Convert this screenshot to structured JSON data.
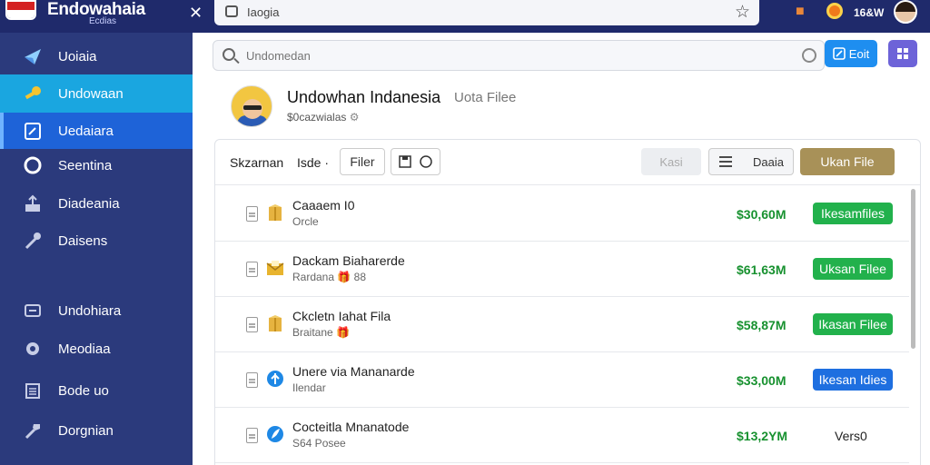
{
  "brand": {
    "title": "Endowahaia",
    "subtitle": "Ecdias",
    "flag_colors": [
      "#d42121",
      "#ffffff"
    ]
  },
  "address_bar": {
    "url": "Iaogia"
  },
  "top_right": {
    "price": "16&W"
  },
  "sidebar": {
    "items": [
      {
        "label": "Uoiaia",
        "icon": "send-icon"
      },
      {
        "label": "Undowaan",
        "icon": "key-icon"
      },
      {
        "label": "Uedaiara",
        "icon": "pen-card-icon"
      },
      {
        "label": "Seentina",
        "icon": "circle-icon"
      },
      {
        "label": "Diadeania",
        "icon": "upload-icon"
      },
      {
        "label": "Daisens",
        "icon": "wrench-icon"
      },
      {
        "label": "Undohiara",
        "icon": "minus-box-icon"
      },
      {
        "label": "Meodiaa",
        "icon": "gear-icon"
      },
      {
        "label": "Bode uo",
        "icon": "calendar-icon"
      },
      {
        "label": "Dorgnian",
        "icon": "tool-icon"
      }
    ]
  },
  "search": {
    "placeholder": "Undomedan"
  },
  "header_buttons": {
    "edit_label": "Eoit"
  },
  "profile": {
    "name": "Undowhan Indanesia",
    "tag": "Uota Filee",
    "subtitle": "$0cazwialas"
  },
  "toolbar": {
    "label1": "Skzarnan",
    "label2": "Isde ·",
    "filter_label": "Filer",
    "disabled_label": "Kasi",
    "list_label": "Daaia",
    "upload_label": "Ukan File"
  },
  "files": [
    {
      "name": "Caaaem I0",
      "sub": "Orcle",
      "size": "$30,60M",
      "action": "Ikesamfiles",
      "action_color": "#22b14c",
      "icon": "box-icon"
    },
    {
      "name": "Dackam Biaharerde",
      "sub": "Rardana 🎁 88",
      "size": "$61,63M",
      "action": "Uksan Filee",
      "action_color": "#22b14c",
      "icon": "mail-icon"
    },
    {
      "name": "Ckcletn Iahat Fila",
      "sub": "Braitane 🎁",
      "size": "$58,87M",
      "action": "Ikasan Filee",
      "action_color": "#22b14c",
      "icon": "box-icon"
    },
    {
      "name": "Unere via Mananarde",
      "sub": "Ilendar",
      "size": "$33,00M",
      "action": "Ikesan Idies",
      "action_color": "#1e6fe0",
      "icon": "shield-icon"
    },
    {
      "name": "Cocteitla Mnanatode",
      "sub": "S64 Posee",
      "size": "$13,2YM",
      "action": "Vers0",
      "action_color": "",
      "icon": "leaf-icon"
    }
  ]
}
